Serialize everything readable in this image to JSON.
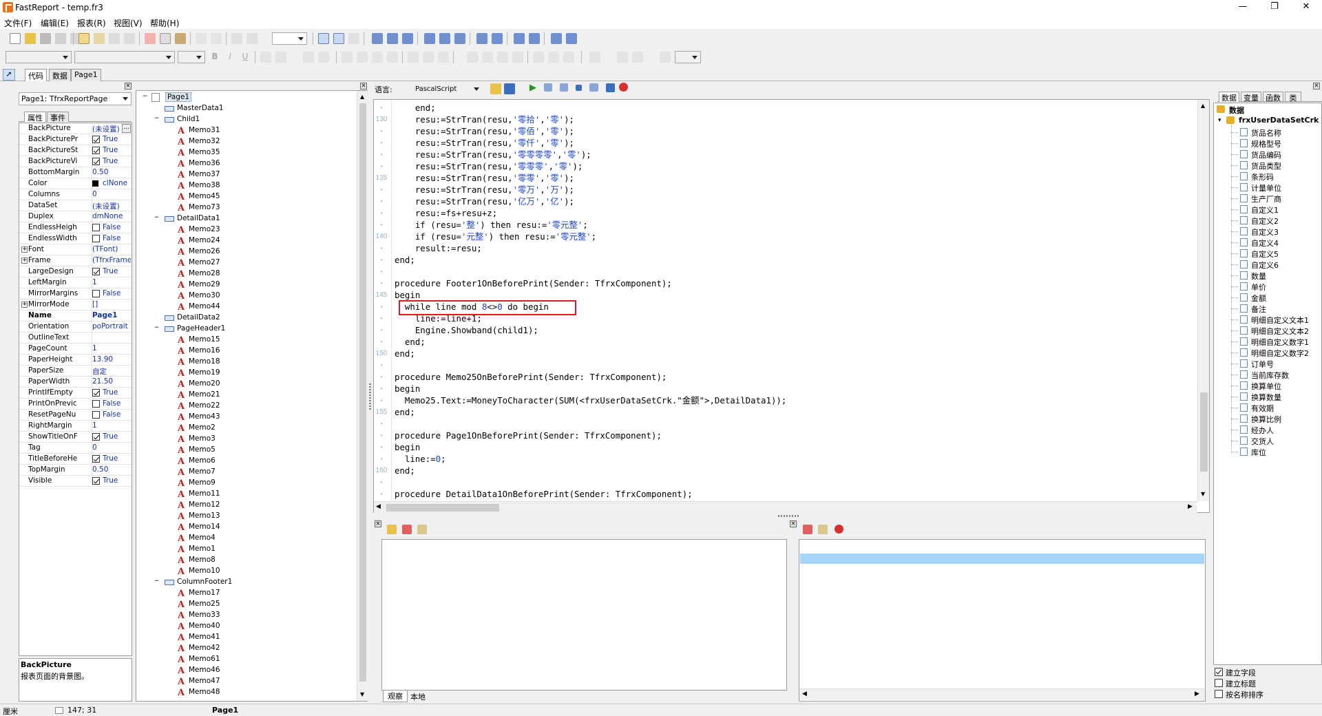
{
  "window": {
    "title": "FastReport - temp.fr3",
    "minimize": "—",
    "maximize": "❐",
    "close": "✕"
  },
  "menu": [
    "文件(F)",
    "编辑(E)",
    "报表(R)",
    "视图(V)",
    "帮助(H)"
  ],
  "tabs": [
    "代码",
    "数据",
    "Page1"
  ],
  "object_inspector": {
    "selector": "Page1: TfrxReportPage",
    "tabs": [
      "属性",
      "事件"
    ],
    "properties": [
      {
        "name": "BackPicture",
        "value": "(未设置)",
        "type": "text",
        "ellipsis": "..."
      },
      {
        "name": "BackPicturePr",
        "value": "True",
        "type": "check",
        "checked": true
      },
      {
        "name": "BackPictureSt",
        "value": "True",
        "type": "check",
        "checked": true
      },
      {
        "name": "BackPictureVi",
        "value": "True",
        "type": "check",
        "checked": true
      },
      {
        "name": "BottomMargin",
        "value": "0.50",
        "type": "text"
      },
      {
        "name": "Color",
        "value": "clNone",
        "type": "color"
      },
      {
        "name": "Columns",
        "value": "0",
        "type": "text"
      },
      {
        "name": "DataSet",
        "value": "(未设置)",
        "type": "text"
      },
      {
        "name": "Duplex",
        "value": "dmNone",
        "type": "text"
      },
      {
        "name": "EndlessHeigh",
        "value": "False",
        "type": "check",
        "checked": false
      },
      {
        "name": "EndlessWidth",
        "value": "False",
        "type": "check",
        "checked": false
      },
      {
        "name": "Font",
        "value": "(TFont)",
        "type": "text",
        "expand": "+"
      },
      {
        "name": "Frame",
        "value": "(TfrxFrame)",
        "type": "text",
        "expand": "+"
      },
      {
        "name": "LargeDesign",
        "value": "True",
        "type": "check",
        "checked": true
      },
      {
        "name": "LeftMargin",
        "value": "1",
        "type": "text"
      },
      {
        "name": "MirrorMargins",
        "value": "False",
        "type": "check",
        "checked": false
      },
      {
        "name": "MirrorMode",
        "value": "[]",
        "type": "text",
        "expand": "+"
      },
      {
        "name": "Name",
        "value": "Page1",
        "type": "text",
        "bold": true
      },
      {
        "name": "Orientation",
        "value": "poPortrait",
        "type": "text"
      },
      {
        "name": "OutlineText",
        "value": "",
        "type": "text"
      },
      {
        "name": "PageCount",
        "value": "1",
        "type": "text"
      },
      {
        "name": "PaperHeight",
        "value": "13.90",
        "type": "text"
      },
      {
        "name": "PaperSize",
        "value": "自定",
        "type": "text"
      },
      {
        "name": "PaperWidth",
        "value": "21.50",
        "type": "text"
      },
      {
        "name": "PrintIfEmpty",
        "value": "True",
        "type": "check",
        "checked": true
      },
      {
        "name": "PrintOnPrevic",
        "value": "False",
        "type": "check",
        "checked": false
      },
      {
        "name": "ResetPageNu",
        "value": "False",
        "type": "check",
        "checked": false
      },
      {
        "name": "RightMargin",
        "value": "1",
        "type": "text"
      },
      {
        "name": "ShowTitleOnF",
        "value": "True",
        "type": "check",
        "checked": true
      },
      {
        "name": "Tag",
        "value": "0",
        "type": "text"
      },
      {
        "name": "TitleBeforeHe",
        "value": "True",
        "type": "check",
        "checked": true
      },
      {
        "name": "TopMargin",
        "value": "0.50",
        "type": "text"
      },
      {
        "name": "Visible",
        "value": "True",
        "type": "check",
        "checked": true
      }
    ],
    "help_title": "BackPicture",
    "help_text": "报表页面的背景图。"
  },
  "tree": [
    {
      "label": "Page1",
      "level": 0,
      "kind": "page",
      "toggle": "−",
      "selected": true
    },
    {
      "label": "MasterData1",
      "level": 1,
      "kind": "band"
    },
    {
      "label": "Child1",
      "level": 1,
      "kind": "band",
      "toggle": "−"
    },
    {
      "label": "Memo31",
      "level": 2,
      "kind": "memo"
    },
    {
      "label": "Memo32",
      "level": 2,
      "kind": "memo"
    },
    {
      "label": "Memo35",
      "level": 2,
      "kind": "memo"
    },
    {
      "label": "Memo36",
      "level": 2,
      "kind": "memo"
    },
    {
      "label": "Memo37",
      "level": 2,
      "kind": "memo"
    },
    {
      "label": "Memo38",
      "level": 2,
      "kind": "memo"
    },
    {
      "label": "Memo45",
      "level": 2,
      "kind": "memo"
    },
    {
      "label": "Memo73",
      "level": 2,
      "kind": "memo"
    },
    {
      "label": "DetailData1",
      "level": 1,
      "kind": "band",
      "toggle": "−"
    },
    {
      "label": "Memo23",
      "level": 2,
      "kind": "memo"
    },
    {
      "label": "Memo24",
      "level": 2,
      "kind": "memo"
    },
    {
      "label": "Memo26",
      "level": 2,
      "kind": "memo"
    },
    {
      "label": "Memo27",
      "level": 2,
      "kind": "memo"
    },
    {
      "label": "Memo28",
      "level": 2,
      "kind": "memo"
    },
    {
      "label": "Memo29",
      "level": 2,
      "kind": "memo"
    },
    {
      "label": "Memo30",
      "level": 2,
      "kind": "memo"
    },
    {
      "label": "Memo44",
      "level": 2,
      "kind": "memo"
    },
    {
      "label": "DetailData2",
      "level": 1,
      "kind": "band"
    },
    {
      "label": "PageHeader1",
      "level": 1,
      "kind": "band",
      "toggle": "−"
    },
    {
      "label": "Memo15",
      "level": 2,
      "kind": "memo"
    },
    {
      "label": "Memo16",
      "level": 2,
      "kind": "memo"
    },
    {
      "label": "Memo18",
      "level": 2,
      "kind": "memo"
    },
    {
      "label": "Memo19",
      "level": 2,
      "kind": "memo"
    },
    {
      "label": "Memo20",
      "level": 2,
      "kind": "memo"
    },
    {
      "label": "Memo21",
      "level": 2,
      "kind": "memo"
    },
    {
      "label": "Memo22",
      "level": 2,
      "kind": "memo"
    },
    {
      "label": "Memo43",
      "level": 2,
      "kind": "memo"
    },
    {
      "label": "Memo2",
      "level": 2,
      "kind": "memo"
    },
    {
      "label": "Memo3",
      "level": 2,
      "kind": "memo"
    },
    {
      "label": "Memo5",
      "level": 2,
      "kind": "memo"
    },
    {
      "label": "Memo6",
      "level": 2,
      "kind": "memo"
    },
    {
      "label": "Memo7",
      "level": 2,
      "kind": "memo"
    },
    {
      "label": "Memo9",
      "level": 2,
      "kind": "memo"
    },
    {
      "label": "Memo11",
      "level": 2,
      "kind": "memo"
    },
    {
      "label": "Memo12",
      "level": 2,
      "kind": "memo"
    },
    {
      "label": "Memo13",
      "level": 2,
      "kind": "memo"
    },
    {
      "label": "Memo14",
      "level": 2,
      "kind": "memo"
    },
    {
      "label": "Memo4",
      "level": 2,
      "kind": "memo"
    },
    {
      "label": "Memo1",
      "level": 2,
      "kind": "memo"
    },
    {
      "label": "Memo8",
      "level": 2,
      "kind": "memo"
    },
    {
      "label": "Memo10",
      "level": 2,
      "kind": "memo"
    },
    {
      "label": "ColumnFooter1",
      "level": 1,
      "kind": "band",
      "toggle": "−"
    },
    {
      "label": "Memo17",
      "level": 2,
      "kind": "memo"
    },
    {
      "label": "Memo25",
      "level": 2,
      "kind": "memo"
    },
    {
      "label": "Memo33",
      "level": 2,
      "kind": "memo"
    },
    {
      "label": "Memo40",
      "level": 2,
      "kind": "memo"
    },
    {
      "label": "Memo41",
      "level": 2,
      "kind": "memo"
    },
    {
      "label": "Memo42",
      "level": 2,
      "kind": "memo"
    },
    {
      "label": "Memo61",
      "level": 2,
      "kind": "memo"
    },
    {
      "label": "Memo46",
      "level": 2,
      "kind": "memo"
    },
    {
      "label": "Memo47",
      "level": 2,
      "kind": "memo"
    },
    {
      "label": "Memo48",
      "level": 2,
      "kind": "memo"
    }
  ],
  "code_editor": {
    "language_label": "语言:",
    "language": "PascalScript",
    "lines": [
      {
        "n": "",
        "parts": [
          [
            "    end;",
            ""
          ]
        ]
      },
      {
        "n": "130",
        "parts": [
          [
            "    resu:=StrTran(resu,",
            ""
          ],
          [
            "'零拾'",
            "s"
          ],
          [
            ",",
            ""
          ],
          [
            "'零'",
            "s"
          ],
          [
            ");",
            ""
          ]
        ]
      },
      {
        "n": "",
        "parts": [
          [
            "    resu:=StrTran(resu,",
            ""
          ],
          [
            "'零佰'",
            "s"
          ],
          [
            ",",
            ""
          ],
          [
            "'零'",
            "s"
          ],
          [
            ");",
            ""
          ]
        ]
      },
      {
        "n": "",
        "parts": [
          [
            "    resu:=StrTran(resu,",
            ""
          ],
          [
            "'零仟'",
            "s"
          ],
          [
            ",",
            ""
          ],
          [
            "'零'",
            "s"
          ],
          [
            ");",
            ""
          ]
        ]
      },
      {
        "n": "",
        "parts": [
          [
            "    resu:=StrTran(resu,",
            ""
          ],
          [
            "'零零零零'",
            "s"
          ],
          [
            ",",
            ""
          ],
          [
            "'零'",
            "s"
          ],
          [
            ");",
            ""
          ]
        ]
      },
      {
        "n": "",
        "parts": [
          [
            "    resu:=StrTran(resu,",
            ""
          ],
          [
            "'零零零'",
            "s"
          ],
          [
            ",",
            ""
          ],
          [
            "'零'",
            "s"
          ],
          [
            ");",
            ""
          ]
        ]
      },
      {
        "n": "135",
        "parts": [
          [
            "    resu:=StrTran(resu,",
            ""
          ],
          [
            "'零零'",
            "s"
          ],
          [
            ",",
            ""
          ],
          [
            "'零'",
            "s"
          ],
          [
            ");",
            ""
          ]
        ]
      },
      {
        "n": "",
        "parts": [
          [
            "    resu:=StrTran(resu,",
            ""
          ],
          [
            "'零万'",
            "s"
          ],
          [
            ",",
            ""
          ],
          [
            "'万'",
            "s"
          ],
          [
            ");",
            ""
          ]
        ]
      },
      {
        "n": "",
        "parts": [
          [
            "    resu:=StrTran(resu,",
            ""
          ],
          [
            "'亿万'",
            "s"
          ],
          [
            ",",
            ""
          ],
          [
            "'亿'",
            "s"
          ],
          [
            ");",
            ""
          ]
        ]
      },
      {
        "n": "",
        "parts": [
          [
            "    resu:=fs+resu+z;",
            ""
          ]
        ]
      },
      {
        "n": "",
        "parts": [
          [
            "    if (resu=",
            ""
          ],
          [
            "'整'",
            "s"
          ],
          [
            ") then resu:=",
            ""
          ],
          [
            "'零元整'",
            "s"
          ],
          [
            ";",
            ""
          ]
        ]
      },
      {
        "n": "140",
        "parts": [
          [
            "    if (resu=",
            ""
          ],
          [
            "'元整'",
            "s"
          ],
          [
            ") then resu:=",
            ""
          ],
          [
            "'零元整'",
            "s"
          ],
          [
            ";",
            ""
          ]
        ]
      },
      {
        "n": "",
        "parts": [
          [
            "    result:=resu;",
            ""
          ]
        ]
      },
      {
        "n": "",
        "parts": [
          [
            "end;",
            ""
          ]
        ]
      },
      {
        "n": "",
        "parts": [
          [
            "",
            ""
          ]
        ]
      },
      {
        "n": "",
        "parts": [
          [
            "procedure Footer1OnBeforePrint(Sender: TfrxComponent);",
            ""
          ]
        ]
      },
      {
        "n": "145",
        "parts": [
          [
            "begin",
            ""
          ]
        ]
      },
      {
        "n": "",
        "parts": [
          [
            "  while line mod ",
            ""
          ],
          [
            "8",
            "s"
          ],
          [
            "<>",
            ""
          ],
          [
            "0",
            "s"
          ],
          [
            " do begin",
            ""
          ]
        ]
      },
      {
        "n": "",
        "parts": [
          [
            "    line:=line+1;",
            ""
          ]
        ]
      },
      {
        "n": "",
        "parts": [
          [
            "    Engine.Showband(child1);",
            ""
          ]
        ]
      },
      {
        "n": "",
        "parts": [
          [
            "  end;",
            ""
          ]
        ]
      },
      {
        "n": "150",
        "parts": [
          [
            "end;",
            ""
          ]
        ]
      },
      {
        "n": "",
        "parts": [
          [
            "",
            ""
          ]
        ]
      },
      {
        "n": "",
        "parts": [
          [
            "procedure Memo25OnBeforePrint(Sender: TfrxComponent);",
            ""
          ]
        ]
      },
      {
        "n": "",
        "parts": [
          [
            "begin",
            ""
          ]
        ]
      },
      {
        "n": "",
        "parts": [
          [
            "  Memo25.Text:=MoneyToCharacter(SUM(<frxUserDataSetCrk.\"金额\">,DetailData1));",
            ""
          ]
        ]
      },
      {
        "n": "155",
        "parts": [
          [
            "end;",
            ""
          ]
        ]
      },
      {
        "n": "",
        "parts": [
          [
            "",
            ""
          ]
        ]
      },
      {
        "n": "",
        "parts": [
          [
            "procedure Page1OnBeforePrint(Sender: TfrxComponent);",
            ""
          ]
        ]
      },
      {
        "n": "",
        "parts": [
          [
            "begin",
            ""
          ]
        ]
      },
      {
        "n": "",
        "parts": [
          [
            "  line:=",
            ""
          ],
          [
            "0",
            "s"
          ],
          [
            ";",
            ""
          ]
        ]
      },
      {
        "n": "160",
        "parts": [
          [
            "end;",
            ""
          ]
        ]
      },
      {
        "n": "",
        "parts": [
          [
            "",
            ""
          ]
        ]
      },
      {
        "n": "",
        "parts": [
          [
            "procedure DetailData1OnBeforePrint(Sender: TfrxComponent);",
            ""
          ]
        ]
      }
    ],
    "highlight_line_index": 17,
    "highlight_color": "#e0191e"
  },
  "bottom_tabs": [
    "观察",
    "本地"
  ],
  "data_panel": {
    "tabs": [
      "数据",
      "变量",
      "函数",
      "类"
    ],
    "root": "数据",
    "dataset": "frxUserDataSetCrk",
    "fields": [
      "货品名称",
      "规格型号",
      "货品编码",
      "货品类型",
      "条形码",
      "计量单位",
      "生产厂商",
      "自定义1",
      "自定义2",
      "自定义3",
      "自定义4",
      "自定义5",
      "自定义6",
      "数量",
      "单价",
      "金额",
      "备注",
      "明细自定义文本1",
      "明细自定义文本2",
      "明细自定义数字1",
      "明细自定义数字2",
      "订单号",
      "当前库存数",
      "换算单位",
      "换算数量",
      "有效期",
      "换算比例",
      "经办人",
      "交货人",
      "库位"
    ],
    "options": [
      {
        "label": "建立字段",
        "checked": true
      },
      {
        "label": "建立标题",
        "checked": false
      },
      {
        "label": "按名称排序",
        "checked": false
      }
    ]
  },
  "status": {
    "unit": "厘米",
    "pos": "147; 31",
    "page": "Page1"
  },
  "colors": {
    "accent": "#e8721c",
    "selection_blue": "#a8d4f8",
    "string_blue": "#1a44c8"
  }
}
